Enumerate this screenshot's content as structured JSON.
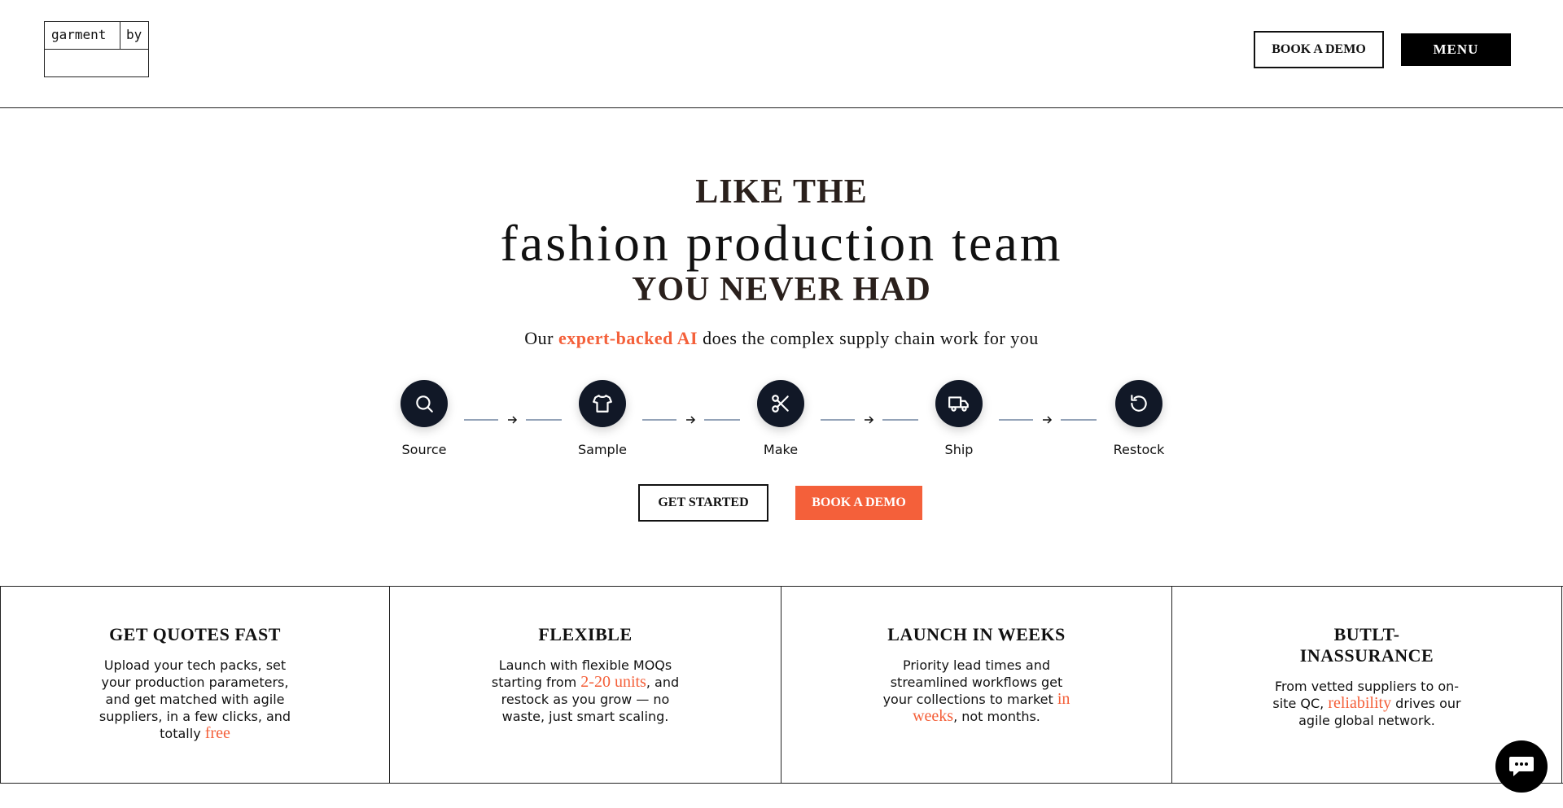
{
  "header": {
    "logo": {
      "word1": "garment",
      "word2": "by"
    },
    "book_demo_label": "BOOK A DEMO",
    "menu_label": "MENU"
  },
  "hero": {
    "line1": "LIKE THE",
    "line2": "fashion production team",
    "line3": "YOU NEVER HAD",
    "subtitle_before": "Our ",
    "subtitle_highlight": "expert-backed AI",
    "subtitle_after": " does the complex supply chain work for you"
  },
  "steps": [
    {
      "label": "Source",
      "icon": "search-icon"
    },
    {
      "label": "Sample",
      "icon": "shirt-icon"
    },
    {
      "label": "Make",
      "icon": "scissors-icon"
    },
    {
      "label": "Ship",
      "icon": "truck-icon"
    },
    {
      "label": "Restock",
      "icon": "refresh-icon"
    }
  ],
  "cta": {
    "get_started_label": "GET STARTED",
    "book_demo_label": "BOOK A DEMO"
  },
  "features": [
    {
      "title": "GET QUOTES FAST",
      "text_before": "Upload your tech packs, set your production parameters, and get matched with agile suppliers, in a few clicks, and totally ",
      "accent": "free",
      "text_after": ""
    },
    {
      "title": "FLEXIBLE",
      "text_before": "Launch with flexible MOQs starting from ",
      "accent": "2-20 units",
      "text_after": ", and restock as you grow — no waste, just smart scaling."
    },
    {
      "title": "LAUNCH IN WEEKS",
      "text_before": "Priority lead times and streamlined workflows get your collections to market ",
      "accent": "in weeks",
      "text_after": ", not months."
    },
    {
      "title": "BUTLT-INASSURANCE",
      "text_before": "From vetted suppliers to on-site QC, ",
      "accent": "reliability",
      "text_after": " drives our agile global network."
    }
  ],
  "colors": {
    "accent": "#f4603a",
    "icon_circle": "#111827",
    "connector": "#94a3b8",
    "heading_dark": "#2a201c"
  },
  "chat": {
    "icon": "chat-icon"
  }
}
